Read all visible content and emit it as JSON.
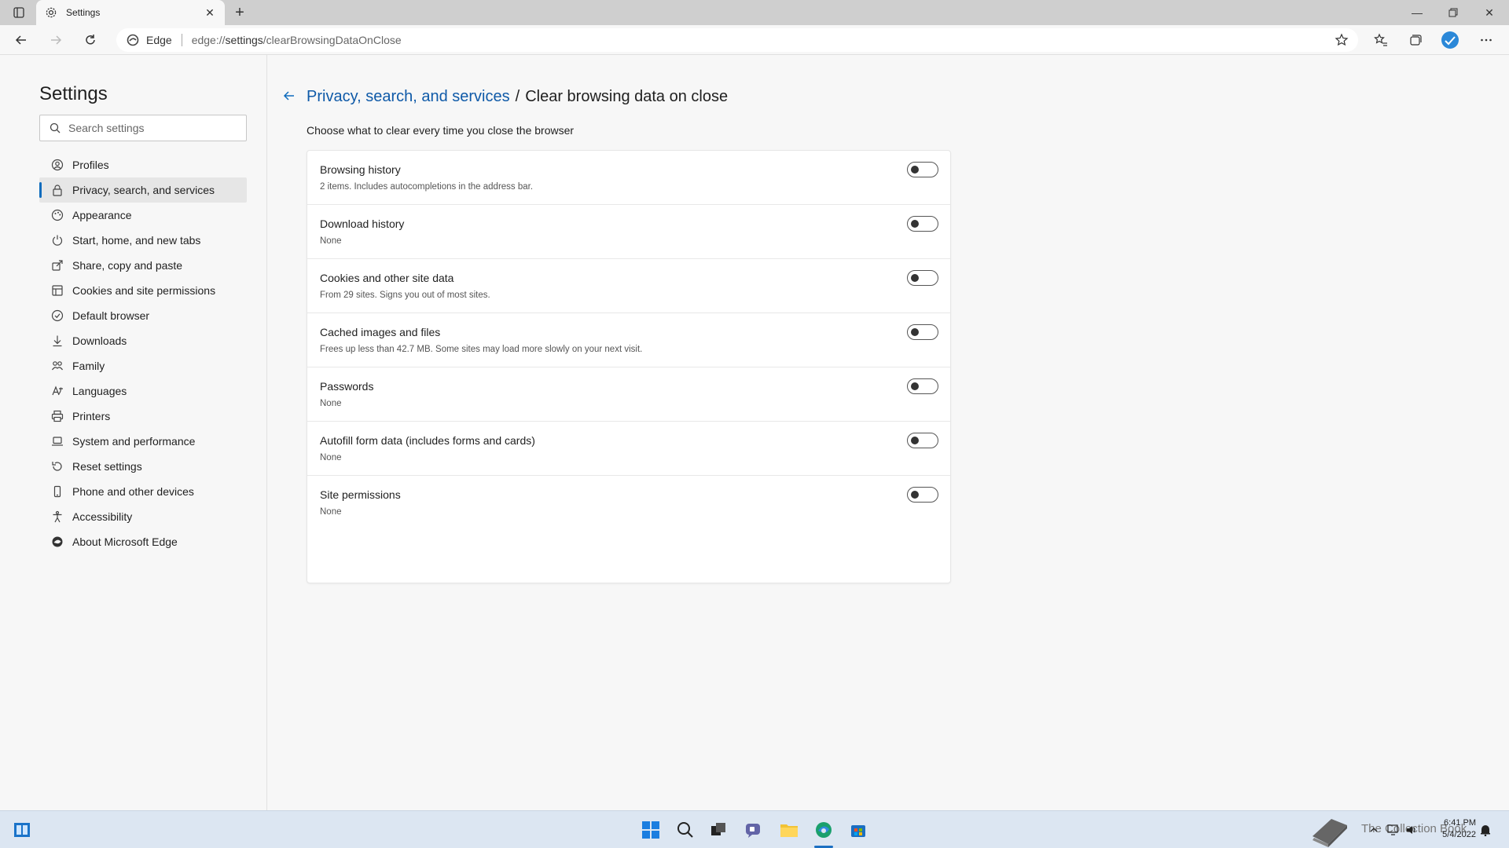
{
  "tab": {
    "title": "Settings"
  },
  "toolbar": {
    "identity_label": "Edge",
    "url_host": "edge://",
    "url_path": "settings",
    "url_rest": "/clearBrowsingDataOnClose"
  },
  "sidebar": {
    "title": "Settings",
    "search_placeholder": "Search settings",
    "items": [
      {
        "label": "Profiles",
        "icon": "profile-icon"
      },
      {
        "label": "Privacy, search, and services",
        "icon": "lock-icon"
      },
      {
        "label": "Appearance",
        "icon": "appearance-icon"
      },
      {
        "label": "Start, home, and new tabs",
        "icon": "power-icon"
      },
      {
        "label": "Share, copy and paste",
        "icon": "share-icon"
      },
      {
        "label": "Cookies and site permissions",
        "icon": "cookies-icon"
      },
      {
        "label": "Default browser",
        "icon": "browser-icon"
      },
      {
        "label": "Downloads",
        "icon": "download-icon"
      },
      {
        "label": "Family",
        "icon": "family-icon"
      },
      {
        "label": "Languages",
        "icon": "language-icon"
      },
      {
        "label": "Printers",
        "icon": "printer-icon"
      },
      {
        "label": "System and performance",
        "icon": "laptop-icon"
      },
      {
        "label": "Reset settings",
        "icon": "reset-icon"
      },
      {
        "label": "Phone and other devices",
        "icon": "phone-icon"
      },
      {
        "label": "Accessibility",
        "icon": "accessibility-icon"
      },
      {
        "label": "About Microsoft Edge",
        "icon": "edge-icon"
      }
    ],
    "active_index": 1
  },
  "main": {
    "breadcrumb_parent": "Privacy, search, and services",
    "breadcrumb_separator": "/",
    "breadcrumb_current": "Clear browsing data on close",
    "subtitle": "Choose what to clear every time you close the browser",
    "rows": [
      {
        "title": "Browsing history",
        "desc": "2 items. Includes autocompletions in the address bar.",
        "enabled": false
      },
      {
        "title": "Download history",
        "desc": "None",
        "enabled": false
      },
      {
        "title": "Cookies and other site data",
        "desc": "From 29 sites. Signs you out of most sites.",
        "enabled": false
      },
      {
        "title": "Cached images and files",
        "desc": "Frees up less than 42.7 MB. Some sites may load more slowly on your next visit.",
        "enabled": false
      },
      {
        "title": "Passwords",
        "desc": "None",
        "enabled": false
      },
      {
        "title": "Autofill form data (includes forms and cards)",
        "desc": "None",
        "enabled": false
      },
      {
        "title": "Site permissions",
        "desc": "None",
        "enabled": false
      }
    ]
  },
  "taskbar": {
    "tray_text": "The Collection Book",
    "time": "6:41 PM",
    "date": "5/4/2022"
  },
  "colors": {
    "accent": "#0f6cbd",
    "link": "#0f5aa8",
    "taskbar": "#dce6f2"
  }
}
